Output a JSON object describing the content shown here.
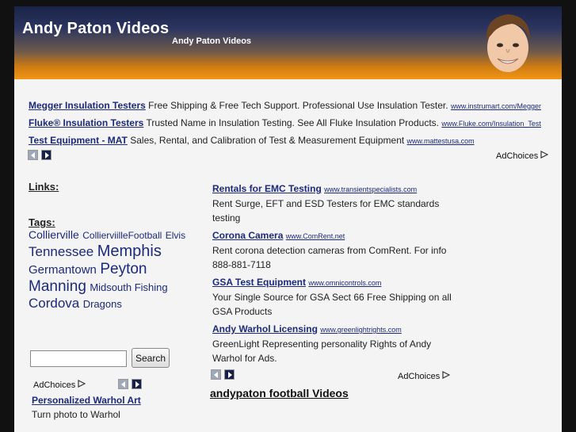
{
  "header": {
    "title": "Andy Paton Videos",
    "subtitle": "Andy Paton Videos"
  },
  "top_ads": [
    {
      "title": "Megger Insulation Testers",
      "desc": "Free Shipping & Free Tech Support. Professional Use Insulation Tester.",
      "url": "www.instrumart.com/Megger"
    },
    {
      "title": "Fluke® Insulation Testers",
      "desc": "Trusted Name in Insulation Testing. See All Fluke Insulation Products.",
      "url": "www.Fluke.com/Insulation_Test"
    },
    {
      "title": "Test Equipment - MAT",
      "desc": "Sales, Rental, and Calibration of Test & Measurement Equipment",
      "url": "www.mattestusa.com"
    }
  ],
  "adchoices_label": "AdChoices",
  "sidebar": {
    "links_heading": "Links:",
    "tags_heading": "Tags:",
    "tags": [
      {
        "label": "Collierville",
        "size": 14
      },
      {
        "label": "CollierviilleFootball",
        "size": 12
      },
      {
        "label": "Elvis",
        "size": 12
      },
      {
        "label": "Tennessee",
        "size": 17
      },
      {
        "label": "Memphis",
        "size": 20
      },
      {
        "label": "Germantown",
        "size": 15
      },
      {
        "label": "Peyton Manning",
        "size": 19
      },
      {
        "label": "Midsouth Fishing",
        "size": 13
      },
      {
        "label": "Cordova",
        "size": 17
      },
      {
        "label": "Dragons",
        "size": 13
      }
    ],
    "search": {
      "value": "",
      "button_label": "Search"
    },
    "ad": {
      "title": "Personalized Warhol Art",
      "desc": "Turn photo to Warhol"
    }
  },
  "main_ads": [
    {
      "title": "Rentals for EMC Testing",
      "url": "www.transientspecialists.com",
      "desc": "Rent Surge, EFT and ESD Testers for EMC standards testing"
    },
    {
      "title": "Corona Camera",
      "url": "www.ComRent.net",
      "desc": "Rent corona detection cameras from ComRent. For info 888-881-7118"
    },
    {
      "title": "GSA Test Equipment",
      "url": "www.omnicontrols.com",
      "desc": "Your Single Source for GSA Sect 66 Free Shipping on all GSA Products"
    },
    {
      "title": "Andy Warhol Licensing",
      "url": "www.greenlightrights.com",
      "desc": "GreenLight Representing personality Rights of Andy Warhol for Ads."
    }
  ],
  "videos_heading": "andypaton football Videos",
  "colors": {
    "link": "#1b2a7a",
    "header_top": "#1a2347",
    "header_bottom": "#f39614"
  }
}
